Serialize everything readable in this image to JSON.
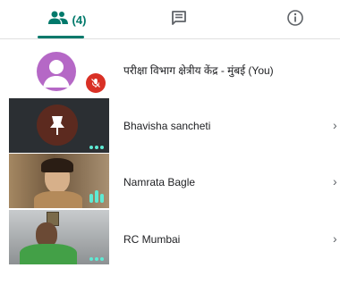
{
  "tabs": {
    "people_count": "(4)",
    "active": "people"
  },
  "participants": [
    {
      "name": "परीक्षा विभाग क्षेत्रीय केंद्र - मुंबई (You)",
      "muted": true
    },
    {
      "name": "Bhavisha sancheti"
    },
    {
      "name": "Namrata Bagle",
      "speaking": true
    },
    {
      "name": "RC Mumbai"
    }
  ],
  "colors": {
    "accent": "#00796b",
    "avatar": "#b568c6",
    "muted_badge": "#d93025",
    "dots": "#5eead4"
  }
}
